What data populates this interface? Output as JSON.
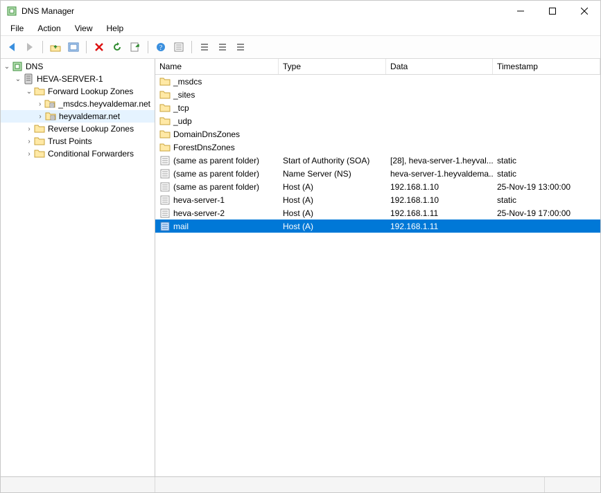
{
  "window": {
    "title": "DNS Manager"
  },
  "menu": {
    "items": [
      "File",
      "Action",
      "View",
      "Help"
    ]
  },
  "tree": {
    "root_label": "DNS",
    "nodes": [
      {
        "indent": 0,
        "twisty": "open",
        "icon": "server",
        "label": "HEVA-SERVER-1"
      },
      {
        "indent": 1,
        "twisty": "open",
        "icon": "folder",
        "label": "Forward Lookup Zones"
      },
      {
        "indent": 2,
        "twisty": "closed",
        "icon": "zone",
        "label": "_msdcs.heyvaldemar.net"
      },
      {
        "indent": 2,
        "twisty": "closed",
        "icon": "zone",
        "label": "heyvaldemar.net",
        "selected": true
      },
      {
        "indent": 1,
        "twisty": "closed",
        "icon": "folder",
        "label": "Reverse Lookup Zones"
      },
      {
        "indent": 1,
        "twisty": "closed",
        "icon": "folder",
        "label": "Trust Points"
      },
      {
        "indent": 1,
        "twisty": "closed",
        "icon": "folder",
        "label": "Conditional Forwarders"
      }
    ]
  },
  "list": {
    "columns": [
      "Name",
      "Type",
      "Data",
      "Timestamp"
    ],
    "rows": [
      {
        "icon": "folder",
        "name": "_msdcs",
        "type": "",
        "data": "",
        "timestamp": ""
      },
      {
        "icon": "folder",
        "name": "_sites",
        "type": "",
        "data": "",
        "timestamp": ""
      },
      {
        "icon": "folder",
        "name": "_tcp",
        "type": "",
        "data": "",
        "timestamp": ""
      },
      {
        "icon": "folder",
        "name": "_udp",
        "type": "",
        "data": "",
        "timestamp": ""
      },
      {
        "icon": "folder",
        "name": "DomainDnsZones",
        "type": "",
        "data": "",
        "timestamp": ""
      },
      {
        "icon": "folder",
        "name": "ForestDnsZones",
        "type": "",
        "data": "",
        "timestamp": ""
      },
      {
        "icon": "record",
        "name": "(same as parent folder)",
        "type": "Start of Authority (SOA)",
        "data": "[28], heva-server-1.heyval...",
        "timestamp": "static"
      },
      {
        "icon": "record",
        "name": "(same as parent folder)",
        "type": "Name Server (NS)",
        "data": "heva-server-1.heyvaldema...",
        "timestamp": "static"
      },
      {
        "icon": "record",
        "name": "(same as parent folder)",
        "type": "Host (A)",
        "data": "192.168.1.10",
        "timestamp": "25-Nov-19 13:00:00"
      },
      {
        "icon": "record",
        "name": "heva-server-1",
        "type": "Host (A)",
        "data": "192.168.1.10",
        "timestamp": "static"
      },
      {
        "icon": "record",
        "name": "heva-server-2",
        "type": "Host (A)",
        "data": "192.168.1.11",
        "timestamp": "25-Nov-19 17:00:00"
      },
      {
        "icon": "record-sel",
        "name": "mail",
        "type": "Host (A)",
        "data": "192.168.1.11",
        "timestamp": "",
        "selected": true
      }
    ]
  }
}
